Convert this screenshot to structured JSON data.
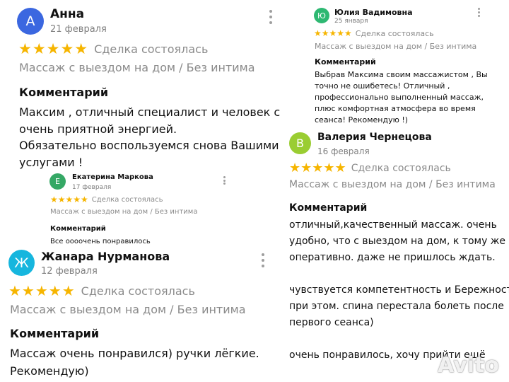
{
  "colors": {
    "avatar_anna": "#3b67e0",
    "avatar_yulia": "#2eb872",
    "avatar_valeria": "#9acd32",
    "avatar_ekaterina": "#35a865",
    "avatar_zhanara": "#16b6de",
    "star": "#f6b500"
  },
  "reviews": {
    "anna": {
      "avatar_letter": "А",
      "name": "Анна",
      "date": "21 февраля",
      "stars": "★★★★★",
      "deal": "Сделка состоялась",
      "service": "Массаж с выездом на дом / Без интима",
      "comment_heading": "Комментарий",
      "comment_lines": [
        "Максим , отличный специалист и человек с",
        "очень приятной энергией.",
        "Обязательно воспользуемся снова Вашими",
        "услугами !"
      ]
    },
    "yulia": {
      "avatar_letter": "Ю",
      "name": "Юлия Вадимовна",
      "date": "25 января",
      "stars": "★★★★★",
      "deal": "Сделка состоялась",
      "service": "Массаж с выездом на дом / Без интима",
      "comment_heading": "Комментарий",
      "comment_lines": [
        "Выбрав Максима своим массажистом , Вы",
        "точно не ошибетесь! Отличный ,",
        "профессионально выполненный массаж,",
        "плюс комфортная атмосфера во время",
        "сеанса! Рекомендую !)"
      ]
    },
    "valeria": {
      "avatar_letter": "В",
      "name": "Валерия Чернецова",
      "date": "16 февраля",
      "stars": "★★★★★",
      "deal": "Сделка состоялась",
      "service": "Массаж с выездом на дом / Без интима",
      "comment_heading": "Комментарий",
      "comment_lines": [
        "отличный,качественный массаж. очень",
        "удобно, что с выездом на дом, к тому же",
        "оперативно. даже не пришлось ждать.",
        "",
        "чувствуется компетентность и Бережность",
        "при этом. спина перестала болеть после",
        "первого сеанса)",
        "",
        "очень понравилось, хочу прийти ещё"
      ]
    },
    "ekaterina": {
      "avatar_letter": "Е",
      "name": "Екатерина Маркова",
      "date": "17 февраля",
      "stars": "★★★★★",
      "deal": "Сделка состоялась",
      "service": "Массаж с выездом на дом / Без интима",
      "comment_heading": "Комментарий",
      "comment_lines": [
        "Все оооочень понравилось"
      ]
    },
    "zhanara": {
      "avatar_letter": "Ж",
      "name": "Жанара Нурманова",
      "date": "12 февраля",
      "stars": "★★★★★",
      "deal": "Сделка состоялась",
      "service": "Массаж с выездом на дом / Без интима",
      "comment_heading": "Комментарий",
      "comment_lines": [
        "Массаж очень понравился) ручки лёгкие.",
        "Рекомендую)"
      ]
    }
  },
  "watermark": "Avito"
}
